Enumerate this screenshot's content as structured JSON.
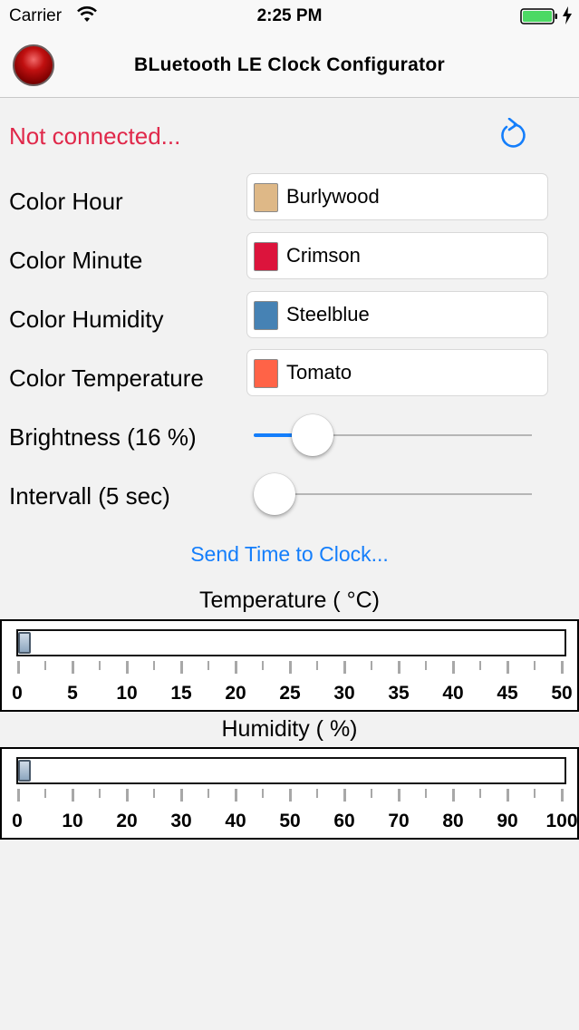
{
  "status_bar": {
    "carrier": "Carrier",
    "time": "2:25 PM"
  },
  "nav": {
    "title": "BLuetooth LE Clock Configurator"
  },
  "connection": {
    "status": "Not connected..."
  },
  "colors": [
    {
      "label": "Color Hour",
      "value": "Burlywood",
      "swatch": "#deb887"
    },
    {
      "label": "Color Minute",
      "value": "Crimson",
      "swatch": "#dc143c"
    },
    {
      "label": "Color Humidity",
      "value": "Steelblue",
      "swatch": "#4682b4"
    },
    {
      "label": "Color Temperature",
      "value": "Tomato",
      "swatch": "#ff6347"
    }
  ],
  "brightness": {
    "label": "Brightness (16 %)",
    "value": 0.16
  },
  "interval": {
    "label": "Intervall (5 sec)",
    "value": 0.0
  },
  "send_time": {
    "label": "Send Time to Clock..."
  },
  "temperature": {
    "title": "Temperature ( °C)",
    "value": 0,
    "min": 0,
    "max": 50,
    "tick_labels": [
      "0",
      "5",
      "10",
      "15",
      "20",
      "25",
      "30",
      "35",
      "40",
      "45",
      "50"
    ]
  },
  "humidity": {
    "title": "Humidity ( %)",
    "value": 0,
    "min": 0,
    "max": 100,
    "tick_labels": [
      "0",
      "10",
      "20",
      "30",
      "40",
      "50",
      "60",
      "70",
      "80",
      "90",
      "100"
    ]
  },
  "theme": {
    "accent": "#147efb",
    "error": "#e0284a"
  }
}
